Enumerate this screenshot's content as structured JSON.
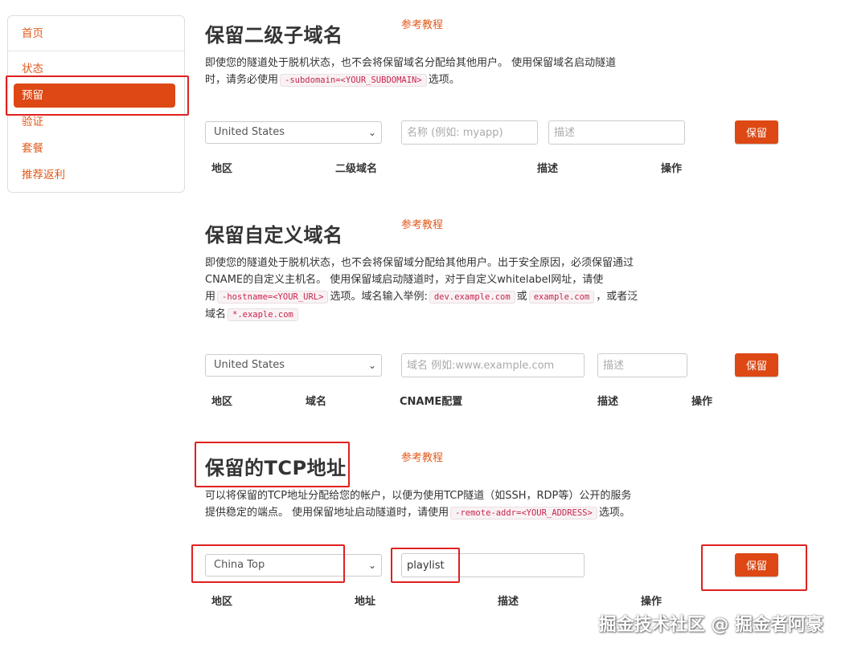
{
  "sidebar": {
    "items": [
      {
        "label": "首页"
      },
      {
        "label": "状态"
      },
      {
        "label": "预留"
      },
      {
        "label": "验证"
      },
      {
        "label": "套餐"
      },
      {
        "label": "推荐返利"
      }
    ]
  },
  "subdomain": {
    "title": "保留二级子域名",
    "tutorial": "参考教程",
    "desc_line1": "即使您的隧道处于脱机状态，也不会将保留域名分配给其他用户。 使用保留域名启动隧道",
    "desc_line2_pre": "时，请务必使用",
    "desc_code": "-subdomain=<YOUR_SUBDOMAIN>",
    "desc_line2_post": "选项。",
    "region": "United States",
    "name_placeholder": "名称 (例如: myapp)",
    "desc_placeholder": "描述",
    "button": "保留",
    "columns": [
      "地区",
      "二级域名",
      "描述",
      "操作"
    ]
  },
  "custom": {
    "title": "保留自定义域名",
    "tutorial": "参考教程",
    "desc_line1": "即使您的隧道处于脱机状态，也不会将保留域分配给其他用户。出于安全原因，必须保留通过",
    "desc_line2": "CNAME的自定义主机名。 使用保留域启动隧道时，对于自定义whitelabel网址，请使",
    "desc_line3_pre": "用",
    "desc_code1": "-hostname=<YOUR_URL>",
    "desc_line3_mid": "选项。域名输入举例:",
    "desc_code2": "dev.example.com",
    "desc_line3_or": "或",
    "desc_code3": "example.com",
    "desc_line3_post": "，或者泛",
    "desc_line4_pre": "域名",
    "desc_code4": "*.exaple.com",
    "region": "United States",
    "domain_placeholder": "域名 例如:www.example.com",
    "desc_placeholder": "描述",
    "button": "保留",
    "columns": [
      "地区",
      "域名",
      "CNAME配置",
      "描述",
      "操作"
    ]
  },
  "tcp": {
    "title": "保留的TCP地址",
    "tutorial": "参考教程",
    "desc_line1": "可以将保留的TCP地址分配给您的帐户，以便为使用TCP隧道（如SSH，RDP等）公开的服务",
    "desc_line2_pre": "提供稳定的端点。 使用保留地址启动隧道时，请使用",
    "desc_code": "-remote-addr=<YOUR_ADDRESS>",
    "desc_line2_post": "选项。",
    "region": "China Top",
    "address_value": "playlist",
    "button": "保留",
    "columns": [
      "地区",
      "地址",
      "描述",
      "操作"
    ]
  },
  "watermark": "掘金技术社区 @ 掘金者阿豪",
  "colors": {
    "accent": "#dd4814",
    "link": "#e05a1c",
    "annotation": "#e02020"
  }
}
